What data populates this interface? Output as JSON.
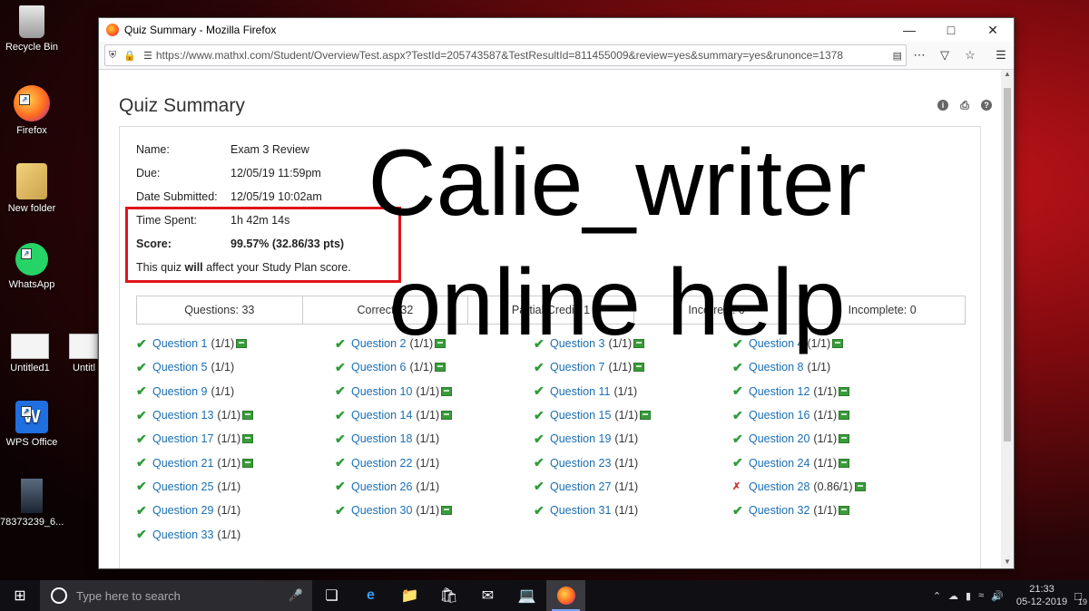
{
  "desktop": {
    "icons": [
      {
        "label": "Recycle Bin"
      },
      {
        "label": "Firefox"
      },
      {
        "label": "New folder"
      },
      {
        "label": "WhatsApp"
      },
      {
        "label": "Untitled1"
      },
      {
        "label": "Untitl"
      },
      {
        "label": "WPS Office"
      },
      {
        "label": "78373239_6..."
      }
    ]
  },
  "window": {
    "title": "Quiz Summary - Mozilla Firefox",
    "url": "https://www.mathxl.com/Student/OverviewTest.aspx?TestId=205743587&TestResultId=811455009&review=yes&summary=yes&runonce=1378"
  },
  "page": {
    "title": "Quiz Summary",
    "info": {
      "name_label": "Name:",
      "name": "Exam 3 Review",
      "due_label": "Due:",
      "due": "12/05/19 11:59pm",
      "submitted_label": "Date Submitted:",
      "submitted": "12/05/19 10:02am",
      "time_label": "Time Spent:",
      "time": "1h 42m 14s",
      "score_label": "Score:",
      "score": "99.57% (32.86/33 pts)",
      "note_pre": "This quiz ",
      "note_bold": "will",
      "note_post": " affect your Study Plan score."
    },
    "counts": {
      "questions": "Questions: 33",
      "correct": "Correct: 32",
      "partial": "Partial Credit: 1",
      "incorrect": "Incorrect: 0",
      "incomplete": "Incomplete: 0"
    },
    "questions": [
      {
        "label": "Question 1",
        "score": "(1/1)",
        "media": true
      },
      {
        "label": "Question 2",
        "score": "(1/1)",
        "media": true
      },
      {
        "label": "Question 3",
        "score": "(1/1)",
        "media": true
      },
      {
        "label": "Question 4",
        "score": "(1/1)",
        "media": true
      },
      {
        "label": "Question 5",
        "score": "(1/1)",
        "media": false
      },
      {
        "label": "Question 6",
        "score": "(1/1)",
        "media": true
      },
      {
        "label": "Question 7",
        "score": "(1/1)",
        "media": true
      },
      {
        "label": "Question 8",
        "score": "(1/1)",
        "media": false
      },
      {
        "label": "Question 9",
        "score": "(1/1)",
        "media": false
      },
      {
        "label": "Question 10",
        "score": "(1/1)",
        "media": true
      },
      {
        "label": "Question 11",
        "score": "(1/1)",
        "media": false
      },
      {
        "label": "Question 12",
        "score": "(1/1)",
        "media": true
      },
      {
        "label": "Question 13",
        "score": "(1/1)",
        "media": true
      },
      {
        "label": "Question 14",
        "score": "(1/1)",
        "media": true
      },
      {
        "label": "Question 15",
        "score": "(1/1)",
        "media": true
      },
      {
        "label": "Question 16",
        "score": "(1/1)",
        "media": true
      },
      {
        "label": "Question 17",
        "score": "(1/1)",
        "media": true
      },
      {
        "label": "Question 18",
        "score": "(1/1)",
        "media": false
      },
      {
        "label": "Question 19",
        "score": "(1/1)",
        "media": false
      },
      {
        "label": "Question 20",
        "score": "(1/1)",
        "media": true
      },
      {
        "label": "Question 21",
        "score": "(1/1)",
        "media": true
      },
      {
        "label": "Question 22",
        "score": "(1/1)",
        "media": false
      },
      {
        "label": "Question 23",
        "score": "(1/1)",
        "media": false
      },
      {
        "label": "Question 24",
        "score": "(1/1)",
        "media": true
      },
      {
        "label": "Question 25",
        "score": "(1/1)",
        "media": false
      },
      {
        "label": "Question 26",
        "score": "(1/1)",
        "media": false
      },
      {
        "label": "Question 27",
        "score": "(1/1)",
        "media": false
      },
      {
        "label": "Question 28",
        "score": "(0.86/1)",
        "media": true,
        "partial": true
      },
      {
        "label": "Question 29",
        "score": "(1/1)",
        "media": false
      },
      {
        "label": "Question 30",
        "score": "(1/1)",
        "media": true
      },
      {
        "label": "Question 31",
        "score": "(1/1)",
        "media": false
      },
      {
        "label": "Question 32",
        "score": "(1/1)",
        "media": true
      },
      {
        "label": "Question 33",
        "score": "(1/1)",
        "media": false
      }
    ]
  },
  "watermark": {
    "line1": "Calie_writer",
    "line2": "online help"
  },
  "taskbar": {
    "search_placeholder": "Type here to search",
    "time": "21:33",
    "date": "05-12-2019",
    "notification_count": "19"
  },
  "colors": {
    "link": "#1a6fb4",
    "check": "#2e9c3a",
    "highlight": "#e0141b"
  }
}
